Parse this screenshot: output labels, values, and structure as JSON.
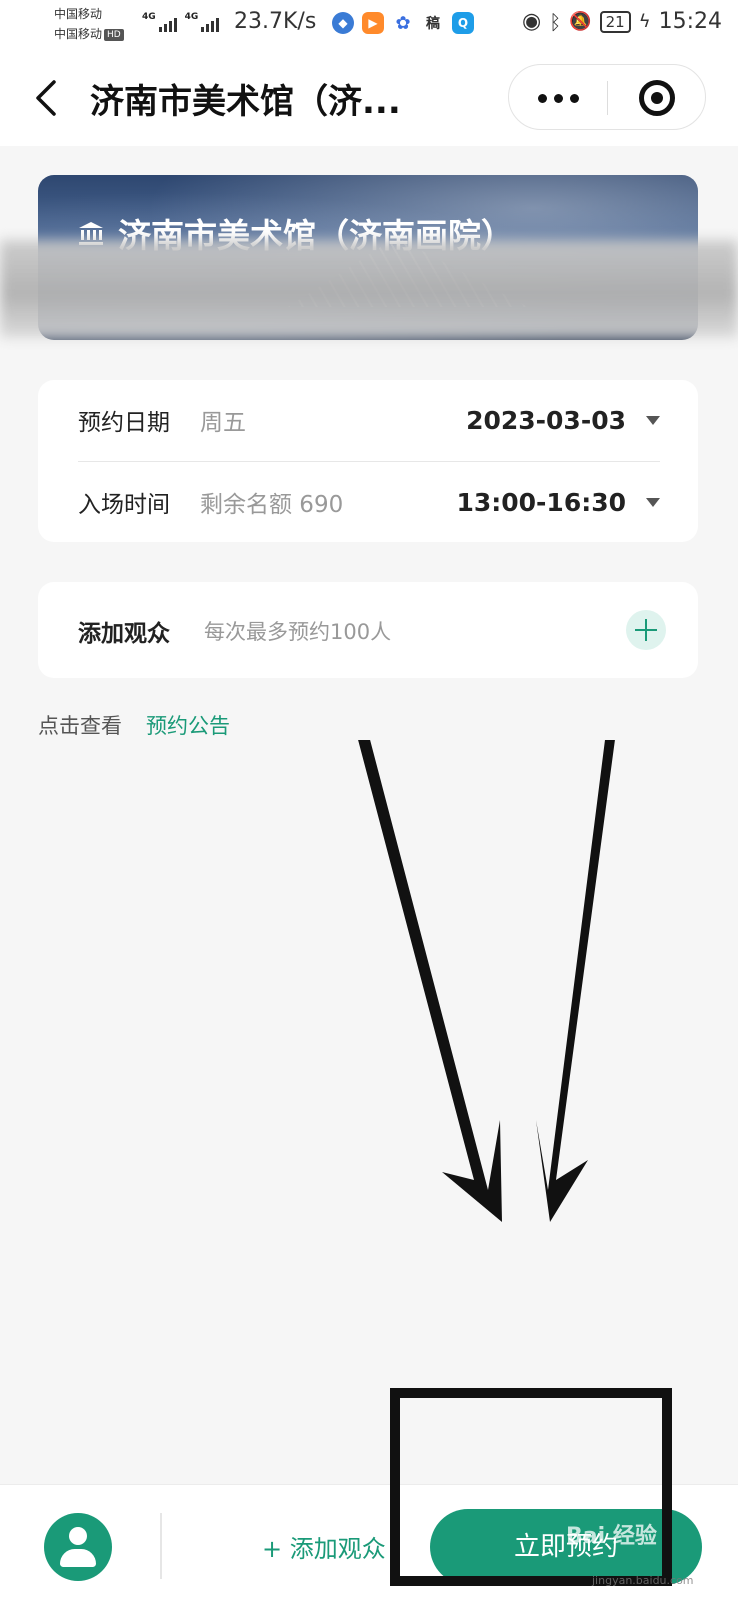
{
  "status_bar": {
    "carrier_1": "中国移动",
    "carrier_2": "中国移动",
    "hd": "HD",
    "network_1": "4G",
    "network_2": "4G",
    "net_speed": "23.7K/s",
    "battery": "21",
    "time": "15:24"
  },
  "nav": {
    "title": "济南市美术馆（济...",
    "more_icon": "more-dots-icon",
    "record_icon": "record-icon"
  },
  "hero": {
    "title": "济南市美术馆（济南画院）",
    "icon": "museum-icon"
  },
  "booking": {
    "date_label": "预约日期",
    "date_sub": "周五",
    "date_value": "2023-03-03",
    "time_label": "入场时间",
    "time_sub": "剩余名额 690",
    "time_value": "13:00-16:30"
  },
  "audience": {
    "label": "添加观众",
    "hint": "每次最多预约100人"
  },
  "notice": {
    "prefix": "点击查看",
    "link": "预约公告"
  },
  "bottom_bar": {
    "add_audience": "+ 添加观众",
    "book_now": "立即预约"
  },
  "watermark": {
    "text": "Bai 经验",
    "sub": "jingyan.baidu.com"
  },
  "colors": {
    "accent": "#1a9a78",
    "background": "#f6f6f6",
    "card": "#ffffff"
  }
}
